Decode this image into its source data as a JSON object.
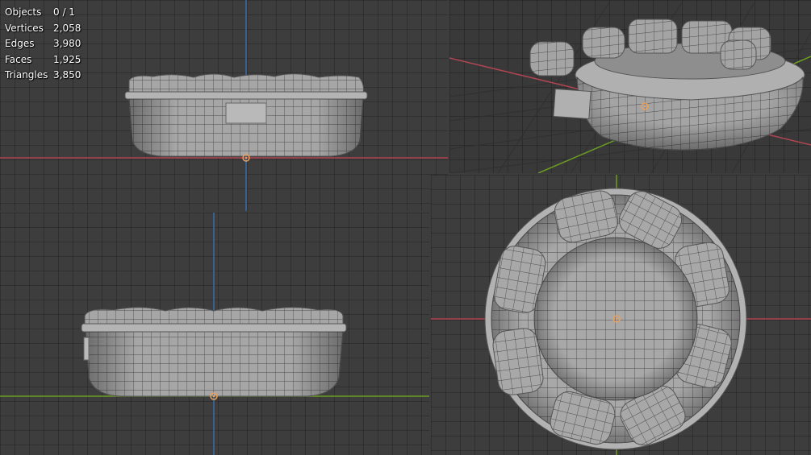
{
  "app": {
    "viewports": [
      {
        "name": "front-ortho"
      },
      {
        "name": "user-perspective"
      },
      {
        "name": "right-ortho"
      },
      {
        "name": "top-ortho"
      }
    ]
  },
  "stats": {
    "rows": [
      {
        "label": "Objects",
        "value": "0 / 1"
      },
      {
        "label": "Vertices",
        "value": "2,058"
      },
      {
        "label": "Edges",
        "value": "3,980"
      },
      {
        "label": "Faces",
        "value": "1,925"
      },
      {
        "label": "Triangles",
        "value": "3,850"
      }
    ]
  },
  "colors": {
    "background": "#3d3d3d",
    "grid": "#303030",
    "x_axis": "#b04552",
    "y_axis": "#6c9b25",
    "z_axis": "#3a6da8",
    "mesh_fill": "#a9a9a9",
    "wire": "#4a4a4a",
    "origin": "#e8a060"
  },
  "icons": {
    "origin": "object-origin-icon",
    "cursor": "3d-cursor-icon"
  }
}
